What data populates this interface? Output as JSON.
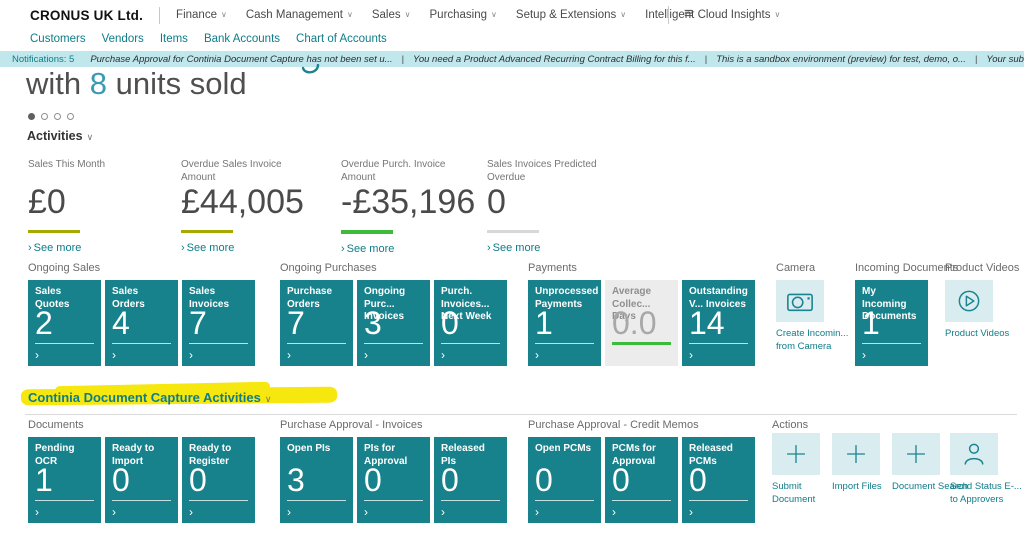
{
  "colors": {
    "accent_teal": "#0e7d89",
    "tile_teal": "#17828c",
    "tile_muted_bg": "#ececec",
    "light_tile_bg": "#d9edf0",
    "notification_bg": "#bfe7ec",
    "highlight_yellow": "#f6e70e",
    "kpi_underline_olive": "#a6aa00",
    "kpi_underline_green": "#3dbb3d",
    "kpi_underline_gray": "#d8d8d8",
    "headline_accent": "#3a9bb0"
  },
  "icons": {
    "chevron_down": "∨",
    "chevron_right": "›",
    "hamburger": "≡",
    "separator": "|"
  },
  "top_nav": {
    "company": "CRONUS UK Ltd.",
    "menus": [
      "Finance",
      "Cash Management",
      "Sales",
      "Purchasing",
      "Setup & Extensions",
      "Intelligent Cloud Insights"
    ]
  },
  "nav_links": [
    "Customers",
    "Vendors",
    "Items",
    "Bank Accounts",
    "Chart of Accounts"
  ],
  "notification_bar": {
    "label": "Notifications: 5",
    "messages": [
      "Purchase Approval for Continia Document Capture has not been set u...",
      "You need a Product Advanced Recurring Contract Billing for this f...",
      "This is a sandbox environment (preview) for test, demo, o...",
      "Your subscription has been canceled. Please buy"
    ]
  },
  "headline": {
    "prefix": "with ",
    "emphasis": "8",
    "suffix": " units sold"
  },
  "activities": {
    "title": "Activities",
    "kpis": [
      {
        "label": "Sales This Month",
        "value": "£0",
        "see_more": "See more",
        "underline_color": "#a6aa00"
      },
      {
        "label": "Overdue Sales Invoice Amount",
        "value": "£44,005",
        "see_more": "See more",
        "underline_color": "#a6aa00"
      },
      {
        "label": "Overdue Purch. Invoice Amount",
        "value": "-£35,196",
        "see_more": "See more",
        "underline_color": "#3dbb3d"
      },
      {
        "label": "Sales Invoices Predicted Overdue",
        "value": "0",
        "see_more": "See more",
        "underline_color": "#d8d8d8"
      }
    ]
  },
  "cue_groups": [
    {
      "title": "Ongoing Sales",
      "tiles": [
        {
          "label": "Sales Quotes",
          "value": "2"
        },
        {
          "label": "Sales Orders",
          "value": "4"
        },
        {
          "label": "Sales Invoices",
          "value": "7"
        }
      ]
    },
    {
      "title": "Ongoing Purchases",
      "tiles": [
        {
          "label": "Purchase Orders",
          "value": "7"
        },
        {
          "label": "Ongoing Purc... Invoices",
          "value": "3"
        },
        {
          "label": "Purch. Invoices... Next Week",
          "value": "0"
        }
      ]
    },
    {
      "title": "Payments",
      "tiles": [
        {
          "label": "Unprocessed Payments",
          "value": "1"
        },
        {
          "label": "Average Collec... Days",
          "value": "0.0"
        },
        {
          "label": "Outstanding V... Invoices",
          "value": "14"
        }
      ]
    },
    {
      "title": "Camera",
      "action": {
        "icon": "camera-icon",
        "label": "Create Incomin... from Camera"
      }
    },
    {
      "title": "Incoming Documents",
      "tiles": [
        {
          "label": "My Incoming Documents",
          "value": "1"
        }
      ]
    },
    {
      "title": "Product Videos",
      "action": {
        "icon": "play-icon",
        "label": "Product Videos"
      }
    }
  ],
  "continia": {
    "title": "Continia Document Capture Activities",
    "groups": [
      {
        "title": "Documents",
        "tiles": [
          {
            "label": "Pending OCR",
            "value": "1"
          },
          {
            "label": "Ready to Import",
            "value": "0"
          },
          {
            "label": "Ready to Register",
            "value": "0"
          }
        ]
      },
      {
        "title": "Purchase Approval - Invoices",
        "tiles": [
          {
            "label": "Open PIs",
            "value": "3"
          },
          {
            "label": "PIs for Approval",
            "value": "0"
          },
          {
            "label": "Released PIs",
            "value": "0"
          }
        ]
      },
      {
        "title": "Purchase Approval - Credit Memos",
        "tiles": [
          {
            "label": "Open PCMs",
            "value": "0"
          },
          {
            "label": "PCMs for Approval",
            "value": "0"
          },
          {
            "label": "Released PCMs",
            "value": "0"
          }
        ]
      },
      {
        "title": "Actions",
        "actions": [
          {
            "icon": "plus-icon",
            "label": "Submit Document"
          },
          {
            "icon": "plus-icon",
            "label": "Import Files"
          },
          {
            "icon": "plus-icon",
            "label": "Document Search"
          },
          {
            "icon": "person-icon",
            "label": "Send Status E-... to Approvers"
          }
        ]
      }
    ]
  }
}
